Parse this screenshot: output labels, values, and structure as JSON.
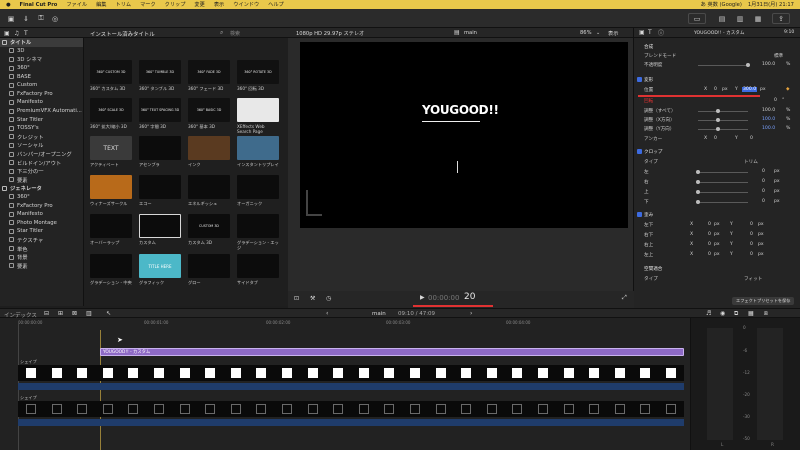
{
  "menubar": {
    "app": "Final Cut Pro",
    "items": [
      "ファイル",
      "編集",
      "トリム",
      "マーク",
      "クリップ",
      "変更",
      "表示",
      "ウインドウ",
      "ヘルプ"
    ],
    "input_method": "あ 英数 (Google)",
    "clock": "1月31日(月) 21:17"
  },
  "browser": {
    "header_title": "インストール済みタイトル",
    "search_placeholder": "検索",
    "sidebar": [
      {
        "label": "タイトル",
        "type": "category",
        "selected": true
      },
      {
        "label": "3D"
      },
      {
        "label": "3D シネマ"
      },
      {
        "label": "360°"
      },
      {
        "label": "BASE"
      },
      {
        "label": "Custom"
      },
      {
        "label": "FxFactory Pro"
      },
      {
        "label": "Manifesto"
      },
      {
        "label": "PremiumVFX Automati..."
      },
      {
        "label": "Star Titler"
      },
      {
        "label": "TOSSY's"
      },
      {
        "label": "クレジット"
      },
      {
        "label": "ソーシャル"
      },
      {
        "label": "バンパー/オープニング"
      },
      {
        "label": "ビルドイン/アウト"
      },
      {
        "label": "下三分の一"
      },
      {
        "label": "要素"
      },
      {
        "label": "ジェネレータ",
        "type": "category"
      },
      {
        "label": "360°"
      },
      {
        "label": "FxFactory Pro"
      },
      {
        "label": "Manifesto"
      },
      {
        "label": "Photo Montage"
      },
      {
        "label": "Star Titler"
      },
      {
        "label": "テクスチャ"
      },
      {
        "label": "単色"
      },
      {
        "label": "背景"
      },
      {
        "label": "要素"
      }
    ],
    "tiles": [
      {
        "thumb": "360° CUSTOM 3D",
        "caption": "360° カスタム 3D"
      },
      {
        "thumb": "360° TUMBLE 3D",
        "caption": "360° タンブル 3D"
      },
      {
        "thumb": "360° FADE 3D",
        "caption": "360° フェード 3D"
      },
      {
        "thumb": "360° ROTATE 3D",
        "caption": "360° 回転 3D"
      },
      {
        "thumb": "360° SCALE 3D",
        "caption": "360° 拡大/縮小 3D"
      },
      {
        "thumb": "360° TEXT SPACING 3D",
        "caption": "360° 字間 3D"
      },
      {
        "thumb": "360° BASIC 3D",
        "caption": "360° 基本 3D"
      },
      {
        "thumb": "",
        "caption": "XEffects Web Search Page"
      },
      {
        "thumb": "TEXT",
        "caption": "アクティベート"
      },
      {
        "thumb": "",
        "caption": "アセンブラ"
      },
      {
        "thumb": "",
        "caption": "インク"
      },
      {
        "thumb": "",
        "caption": "インスタントリプレイ"
      },
      {
        "thumb": "",
        "caption": "ウィナーズサークル"
      },
      {
        "thumb": "",
        "caption": "エコー"
      },
      {
        "thumb": "",
        "caption": "エネルギッシュ"
      },
      {
        "thumb": "",
        "caption": "オーガニック"
      },
      {
        "thumb": "",
        "caption": "オーバーラップ"
      },
      {
        "thumb": "",
        "caption": "カスタム"
      },
      {
        "thumb": "CUSTOM 3D",
        "caption": "カスタム 3D"
      },
      {
        "thumb": "",
        "caption": "グラデーション - エッジ"
      },
      {
        "thumb": "",
        "caption": "グラデーション - 中央"
      },
      {
        "thumb": "TITLE HERE",
        "caption": "グラフィック"
      },
      {
        "thumb": "",
        "caption": "グロー"
      },
      {
        "thumb": "",
        "caption": "サイドタブ"
      }
    ]
  },
  "viewer": {
    "format": "1080p HD 29.97p ステレオ",
    "project": "main",
    "zoom": "86%",
    "view_menu": "表示",
    "canvas_text": "YOUGOOD!!",
    "timecode": "00:00:00",
    "timecode_frames": "20"
  },
  "inspector": {
    "clip_name": "YOUGOOD!! - カスタム",
    "duration": "9:10",
    "compositing": "合成",
    "blend_mode_label": "ブレンドモード",
    "blend_mode_value": "標準",
    "opacity_label": "不透明度",
    "opacity_value": "100.0",
    "opacity_unit": "%",
    "transform": "変形",
    "position_label": "位置",
    "position_x_label": "X",
    "position_x": "0",
    "position_y_label": "Y",
    "position_y": "300.0",
    "unit_px": "px",
    "rotation_label": "回転",
    "rotation_value": "0",
    "rotation_unit": "°",
    "scale_all_label": "調整（すべて）",
    "scale_all": "100.0",
    "scale_x_label": "調整（X方向）",
    "scale_x": "100.0",
    "scale_y_label": "調整（Y方向）",
    "scale_y": "100.0",
    "anchor_label": "アンカー",
    "anchor_x": "0",
    "anchor_y": "0",
    "crop": "クロップ",
    "crop_type_label": "タイプ",
    "crop_type_value": "トリム",
    "crop_left": "左",
    "crop_right": "右",
    "crop_top": "上",
    "crop_bottom": "下",
    "crop_value": "0",
    "distort": "歪み",
    "distort_bl": "左下",
    "distort_br": "右下",
    "distort_tr": "右上",
    "distort_tl": "左上",
    "conform": "空間適合",
    "conform_type_label": "タイプ",
    "conform_type_value": "フィット",
    "save_preset": "エフェクトプリセットを保存"
  },
  "timeline": {
    "index_label": "インデックス",
    "project": "main",
    "position": "09:10 / 47:09",
    "ruler": [
      "00:00:00:00",
      "00:00:01:00",
      "00:00:02:00",
      "00:00:03:00",
      "00:00:04:00"
    ],
    "title_clip": "YOUGOOD!! - カスタム",
    "lane1_label": "シェイプ",
    "lane2_label": "シェイプ"
  },
  "meter": {
    "scale": [
      "0",
      "-6",
      "-12",
      "-20",
      "-30",
      "-50"
    ],
    "left": "L",
    "right": "R"
  },
  "colors": {
    "menubar": "#e9c84b",
    "selection_blue": "#3d6be0",
    "title_clip": "#8e6ac6",
    "audio_lane": "#1f3c6b",
    "playhead": "#e6c04a",
    "red_highlight": "#e03232"
  }
}
